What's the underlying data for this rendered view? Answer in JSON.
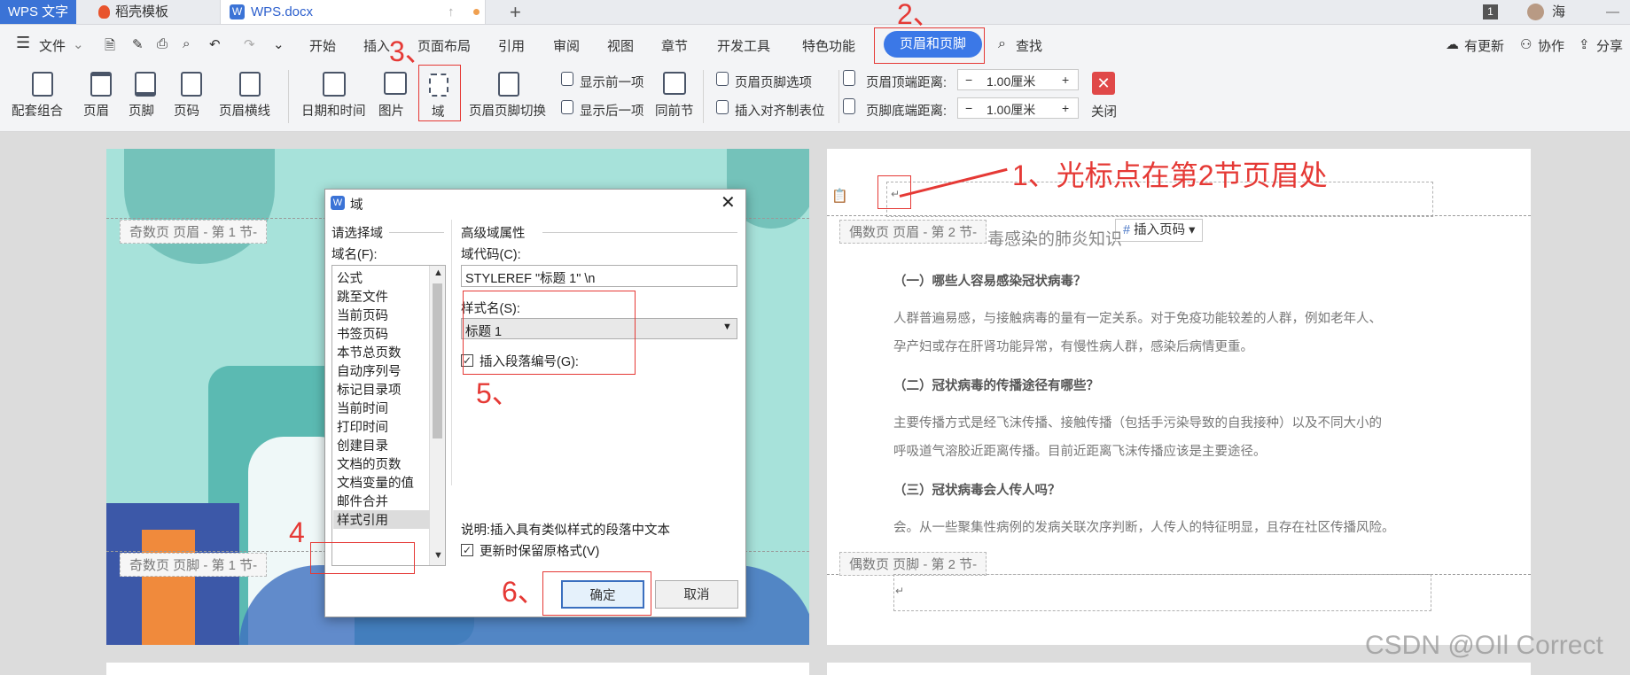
{
  "tabs": {
    "app": "WPS 文字",
    "template": "稻壳模板",
    "doc": "WPS.docx",
    "add": "+",
    "page_badge": "1",
    "user": "海"
  },
  "menu": {
    "file": "文件",
    "items": [
      "开始",
      "插入",
      "页面布局",
      "引用",
      "审阅",
      "视图",
      "章节",
      "开发工具",
      "特色功能"
    ],
    "active": "页眉和页脚",
    "search": "查找",
    "right": [
      "有更新",
      "协作",
      "分享"
    ]
  },
  "ribbon": {
    "combo": "配套组合",
    "header": "页眉",
    "footer": "页脚",
    "pagenum": "页码",
    "headerline": "页眉横线",
    "datetime": "日期和时间",
    "picture": "图片",
    "field": "域",
    "switch": "页眉页脚切换",
    "show_prev": "显示前一项",
    "show_next": "显示后一项",
    "same_prev": "同前节",
    "hf_options": "页眉页脚选项",
    "insert_tab": "插入对齐制表位",
    "top_dist_label": "页眉顶端距离:",
    "top_dist": "1.00厘米",
    "bottom_dist_label": "页脚底端距离:",
    "bottom_dist": "1.00厘米",
    "minus": "−",
    "plus": "+",
    "close": "关闭"
  },
  "annotations": {
    "n1": "1、光标点在第2节页眉处",
    "n2": "2、",
    "n3": "3、",
    "n4": "4",
    "n5": "5、",
    "n6": "6、"
  },
  "left_page": {
    "header_tag": "奇数页 页眉 - 第 1 节-",
    "footer_tag": "奇数页 页脚 - 第 1 节-"
  },
  "right_page": {
    "header_tag": "偶数页 页眉 - 第 2 节-",
    "footer_tag": "偶数页 页脚 - 第 2 节-",
    "insert_pagenum": "插入页码",
    "title_partial": "毒感染的肺炎知识",
    "q1": "（一）哪些人容易感染冠状病毒？",
    "p1a": "人群普遍易感，与接触病毒的量有一定关系。对于免疫功能较差的人群，例如老年人、",
    "p1b": "孕产妇或存在肝肾功能异常，有慢性病人群，感染后病情更重。",
    "q2": "（二）冠状病毒的传播途径有哪些？",
    "p2a": "主要传播方式是经飞沫传播、接触传播（包括手污染导致的自我接种）以及不同大小的",
    "p2b": "呼吸道气溶胶近距离传播。目前近距离飞沫传播应该是主要途径。",
    "q3": "（三）冠状病毒会人传人吗？",
    "p3": "会。从一些聚集性病例的发病关联次序判断，人传人的特征明显，且存在社区传播风险。"
  },
  "dialog": {
    "title": "域",
    "choose_field": "请选择域",
    "field_name": "域名(F):",
    "fields": [
      "公式",
      "跳至文件",
      "当前页码",
      "书签页码",
      "本节总页数",
      "自动序列号",
      "标记目录项",
      "当前时间",
      "打印时间",
      "创建目录",
      "文档的页数",
      "文档变量的值",
      "邮件合并",
      "样式引用"
    ],
    "selected_field": "样式引用",
    "advanced": "高级域属性",
    "field_code_label": "域代码(C):",
    "field_code": "STYLEREF \"标题 1\" \\n",
    "style_name_label": "样式名(S):",
    "style_name": "标题 1",
    "insert_para_num": "插入段落编号(G):",
    "desc": "说明:插入具有类似样式的段落中文本",
    "keep_format": "更新时保留原格式(V)",
    "ok": "确定",
    "cancel": "取消"
  },
  "watermark": "CSDN @OIl Correct"
}
